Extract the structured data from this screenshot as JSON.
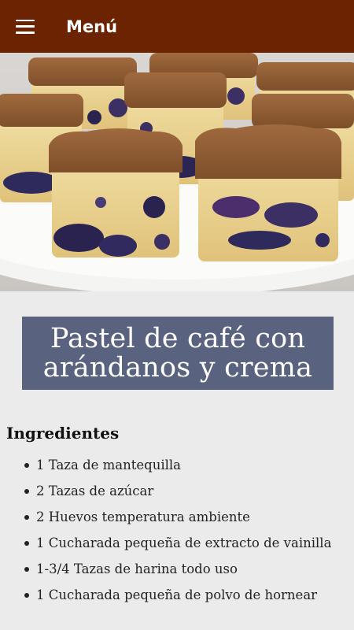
{
  "appbar": {
    "title": "Menú",
    "background": "#6b2302",
    "menu_icon": "hamburger-menu-icon"
  },
  "hero": {
    "description": "blueberry coffee cake squares with crumb topping on white plate"
  },
  "recipe": {
    "title": "Pastel de café con arándanos y crema",
    "title_bg": "#59627f"
  },
  "ingredients": {
    "heading": "Ingredientes",
    "items": [
      "1 Taza de mantequilla",
      "2 Tazas de azúcar",
      "2 Huevos temperatura ambiente",
      "1 Cucharada pequeña de extracto de vainilla",
      "1-3/4 Tazas de harina todo uso",
      "1 Cucharada pequeña de polvo de hornear"
    ]
  }
}
